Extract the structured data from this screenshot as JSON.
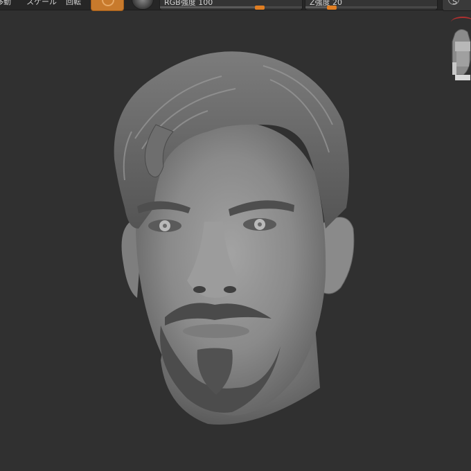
{
  "toolbar": {
    "move_label": "移動",
    "scale_label": "スケール",
    "rotate_label": "回転",
    "rgb_label": "RGB強度",
    "rgb_value": "100",
    "rgb_fraction": 0.7,
    "z_label": "Z強度",
    "z_value": "20",
    "z_fraction": 0.2,
    "right_label": "S"
  },
  "colors": {
    "accent": "#e07e22",
    "active_tool": "#c87a2c",
    "background": "#303030"
  },
  "icons": {
    "draw_tool": "draw-brush-icon",
    "material": "material-sphere-icon",
    "nav": "navigation-cube-icon"
  }
}
